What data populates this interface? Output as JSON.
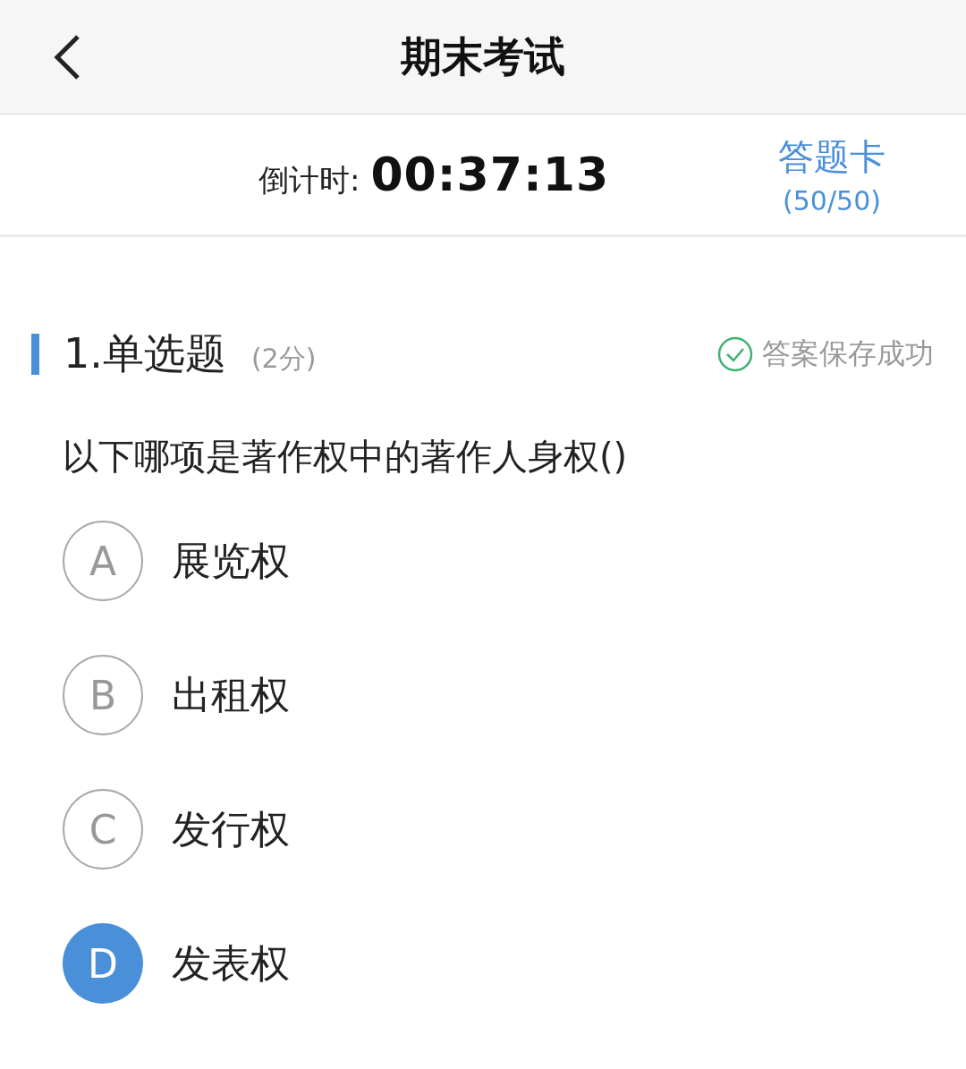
{
  "header": {
    "title": "期末考试"
  },
  "timer": {
    "label": "倒计时:",
    "value": "00:37:13"
  },
  "answer_card": {
    "label": "答题卡",
    "count": "(50/50)"
  },
  "question": {
    "number_type": "1.单选题",
    "score": "(2分)",
    "save_status": "答案保存成功",
    "text": "以下哪项是著作权中的著作人身权()",
    "options": [
      {
        "letter": "A",
        "text": "展览权",
        "selected": false
      },
      {
        "letter": "B",
        "text": "出租权",
        "selected": false
      },
      {
        "letter": "C",
        "text": "发行权",
        "selected": false
      },
      {
        "letter": "D",
        "text": "发表权",
        "selected": true
      }
    ]
  }
}
